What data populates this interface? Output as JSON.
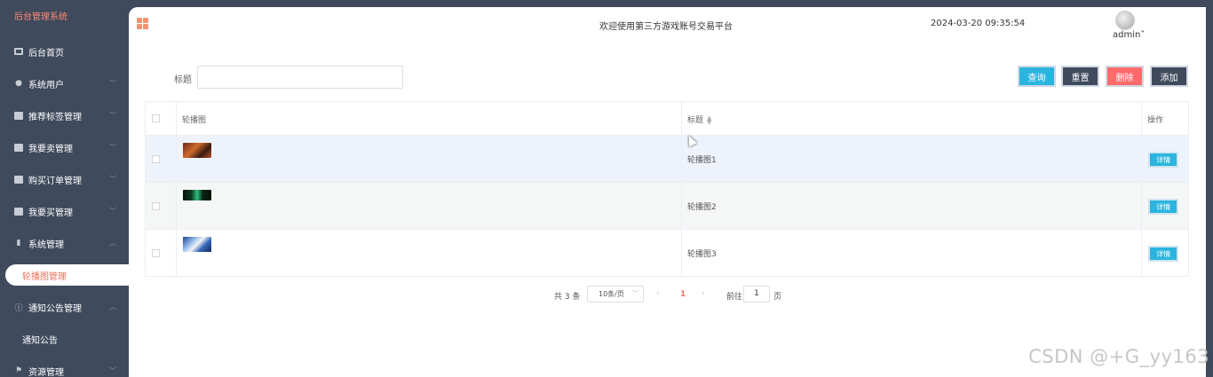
{
  "sidebar": {
    "brand": "后台管理系统",
    "items": [
      {
        "label": "后台首页",
        "icon": "monitor-icon"
      },
      {
        "label": "系统用户",
        "icon": "user-icon"
      },
      {
        "label": "推荐标签管理",
        "icon": "box-icon"
      },
      {
        "label": "我要卖管理",
        "icon": "box-icon"
      },
      {
        "label": "购买订单管理",
        "icon": "box-icon"
      },
      {
        "label": "我要买管理",
        "icon": "box-icon"
      },
      {
        "label": "系统管理",
        "icon": "bar-chart-icon"
      },
      {
        "label": "轮播图管理",
        "active": true
      },
      {
        "label": "通知公告管理",
        "icon": "info-icon"
      },
      {
        "label": "通知公告"
      },
      {
        "label": "资源管理",
        "icon": "flag-icon"
      }
    ]
  },
  "header": {
    "welcome": "欢迎使用第三方游戏账号交易平台",
    "datetime": "2024-03-20 09:35:54",
    "user": "admin"
  },
  "search": {
    "label": "标题",
    "value": "",
    "buttons": {
      "query": "查询",
      "reset": "重置",
      "delete": "删除",
      "add": "添加"
    }
  },
  "table": {
    "columns": [
      "轮播图",
      "标题",
      "操作"
    ],
    "rows": [
      {
        "title": "轮播图1",
        "action": "详情"
      },
      {
        "title": "轮播图2",
        "action": "详情"
      },
      {
        "title": "轮播图3",
        "action": "详情"
      }
    ]
  },
  "pagination": {
    "total": "共 3 条",
    "page_size": "10条/页",
    "current_page": "1",
    "goto_label": "前往",
    "goto_value": "1",
    "page_unit": "页"
  },
  "watermark": "CSDN @+G_yy163",
  "colors": {
    "sidebar_bg": "#3f4a5c",
    "accent": "#f26e5b",
    "query": "#2bb5de",
    "delete": "#ff6b6b"
  }
}
